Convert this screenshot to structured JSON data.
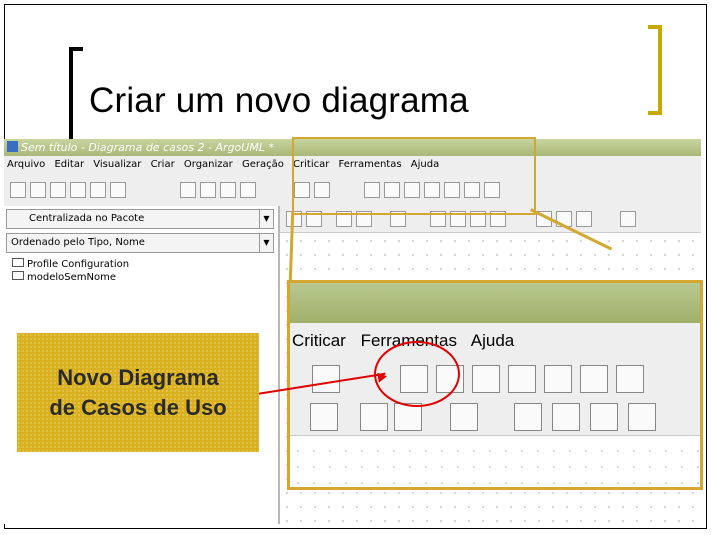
{
  "slide": {
    "title": "Criar um novo diagrama"
  },
  "window": {
    "title": "Sem título - Diagrama de casos 2 - ArgoUML *"
  },
  "menu": [
    "Arquivo",
    "Editar",
    "Visualizar",
    "Criar",
    "Organizar",
    "Geração",
    "Criticar",
    "Ferramentas",
    "Ajuda"
  ],
  "left_pane": {
    "combo1": "Centralizada no Pacote",
    "combo2": "Ordenado pelo Tipo, Nome",
    "tree": [
      "Profile Configuration",
      "modeloSemNome"
    ]
  },
  "zoom": {
    "menu": [
      "Criticar",
      "Ferramentas",
      "Ajuda"
    ]
  },
  "callout": {
    "line1": "Novo Diagrama",
    "line2": "de Casos de Uso"
  },
  "colors": {
    "accent": "#d4a830",
    "highlight": "#e00000",
    "titlebar": "#a9b878"
  }
}
